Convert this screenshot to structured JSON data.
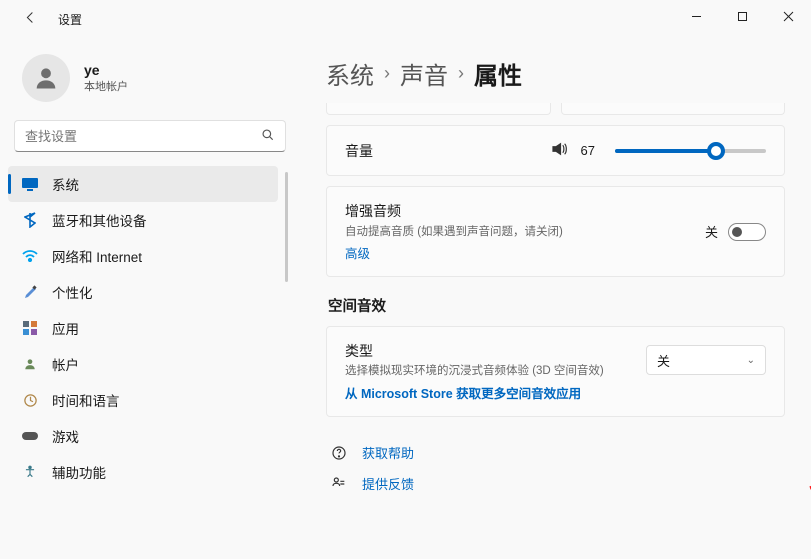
{
  "window": {
    "title": "设置"
  },
  "user": {
    "name": "ye",
    "subtitle": "本地帐户"
  },
  "search": {
    "placeholder": "查找设置"
  },
  "sidebar": {
    "items": [
      {
        "label": "系统",
        "active": true
      },
      {
        "label": "蓝牙和其他设备"
      },
      {
        "label": "网络和 Internet"
      },
      {
        "label": "个性化"
      },
      {
        "label": "应用"
      },
      {
        "label": "帐户"
      },
      {
        "label": "时间和语言"
      },
      {
        "label": "游戏"
      },
      {
        "label": "辅助功能"
      }
    ]
  },
  "breadcrumb": {
    "a": "系统",
    "b": "声音",
    "c": "属性"
  },
  "volume": {
    "label": "音量",
    "value": "67",
    "percent": 67
  },
  "enhance": {
    "title": "增强音频",
    "desc": "自动提高音质 (如果遇到声音问题，请关闭)",
    "advanced": "高级",
    "toggle_label": "关",
    "on": false
  },
  "spatial": {
    "section_title": "空间音效",
    "title": "类型",
    "desc": "选择模拟现实环境的沉浸式音频体验 (3D 空间音效)",
    "store_link": "从 Microsoft Store 获取更多空间音效应用",
    "selected": "关"
  },
  "help": {
    "get_help": "获取帮助",
    "feedback": "提供反馈"
  }
}
